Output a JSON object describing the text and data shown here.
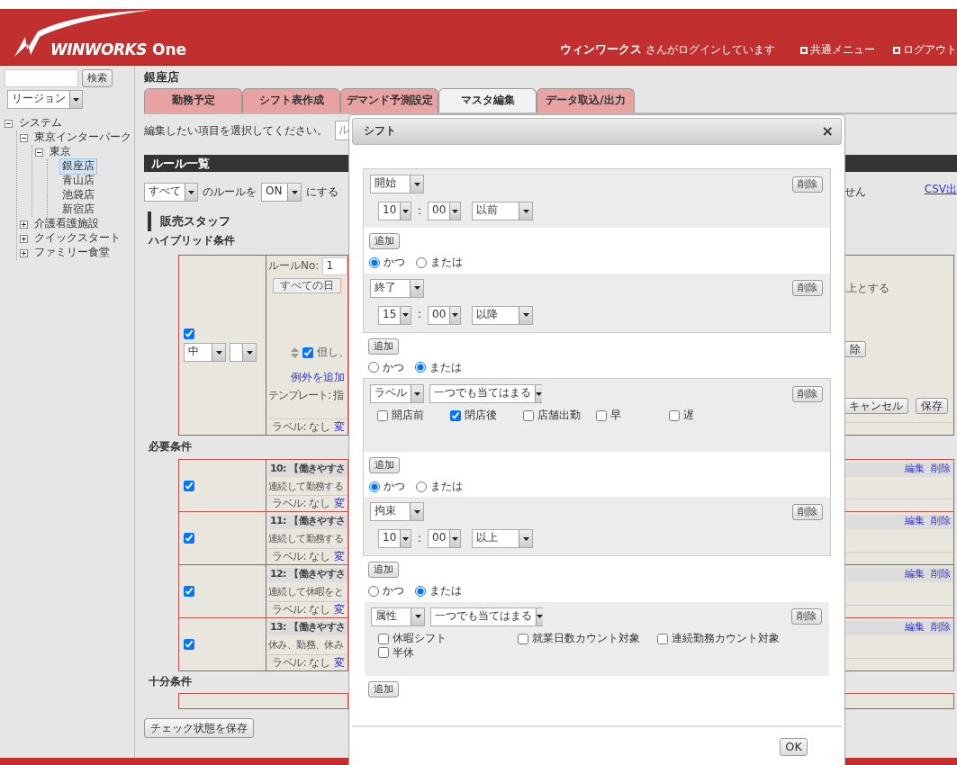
{
  "header": {
    "logo": {
      "word": "WINWORKS",
      "suffix": "One"
    },
    "user": {
      "name": "ウィンワークス",
      "suffix": "さんがログインしています"
    },
    "links": [
      "共通メニュー",
      "ログアウト"
    ]
  },
  "sidebar": {
    "search_button": "検索",
    "region_select": "リージョン",
    "tree": [
      {
        "label": "システム",
        "expanded": true,
        "selected": false,
        "children": [
          {
            "label": "東京インターパーク",
            "expanded": true,
            "selected": false,
            "children": [
              {
                "label": "東京",
                "expanded": true,
                "selected": false,
                "children": [
                  {
                    "label": "銀座店",
                    "selected": true
                  },
                  {
                    "label": "青山店",
                    "selected": false
                  },
                  {
                    "label": "池袋店",
                    "selected": false
                  },
                  {
                    "label": "新宿店",
                    "selected": false
                  }
                ]
              }
            ]
          },
          {
            "label": "介護看護施設",
            "expanded": false,
            "selected": false
          },
          {
            "label": "クイックスタート",
            "expanded": false,
            "selected": false
          },
          {
            "label": "ファミリー食堂",
            "expanded": false,
            "selected": false
          }
        ]
      }
    ]
  },
  "store_title": "銀座店",
  "tabs": [
    {
      "label": "勤務予定",
      "selected": false
    },
    {
      "label": "シフト表作成",
      "selected": false
    },
    {
      "label": "デマンド予測設定",
      "selected": false
    },
    {
      "label": "マスタ編集",
      "selected": true
    },
    {
      "label": "データ取込/出力",
      "selected": false
    }
  ],
  "main": {
    "instruction": "編集したい項目を選択してください。",
    "item_select": "ル",
    "section_title": "ルール一覧",
    "bulk": {
      "scope": "すべて",
      "text1": "のルールを",
      "state": "ON",
      "text2": "にする"
    },
    "notice": "せん",
    "csv_link": "CSV出",
    "group_title": "販売スタッフ",
    "hybrid": {
      "title": "ハイブリッド条件",
      "enabled": true,
      "priority": "中",
      "rule_no_label": "ルールNo:",
      "rule_no": "1",
      "day_button": "すべての日",
      "exception_checked": true,
      "exception_text": "但し、",
      "add_exception": "例外を追加",
      "template": "テンプレート: 指",
      "label_text": "ラベル: なし",
      "change_link": "変",
      "right_text": "上とする",
      "delete_button": "除",
      "cancel_button": "キャンセル",
      "save_button": "保存"
    },
    "required": {
      "title": "必要条件",
      "rules": [
        {
          "checked": true,
          "title": "10: 【働きやすさ",
          "summary": "連続して勤務する",
          "label_text": "ラベル: なし",
          "change_link": "変",
          "edit_link": "編集",
          "delete_link": "削除"
        },
        {
          "checked": true,
          "title": "11: 【働きやすさ",
          "summary": "連続して勤務する",
          "label_text": "ラベル: なし",
          "change_link": "変",
          "edit_link": "編集",
          "delete_link": "削除"
        },
        {
          "checked": true,
          "title": "12: 【働きやすさ",
          "summary": "連続して休暇をと",
          "label_text": "ラベル: なし",
          "change_link": "変",
          "edit_link": "編集",
          "delete_link": "削除"
        },
        {
          "checked": true,
          "title": "13: 【働きやすさ",
          "summary": "休み、勤務、休み",
          "label_text": "ラベル: なし",
          "change_link": "変",
          "edit_link": "編集",
          "delete_link": "削除"
        }
      ]
    },
    "sufficient": {
      "title": "十分条件"
    },
    "save_button": "チェック状態を保存"
  },
  "modal": {
    "title": "シフト",
    "close": "×",
    "ok_button": "OK",
    "blocks": [
      {
        "kind": "group",
        "items": [
          {
            "kind": "time",
            "field": "開始",
            "delete": "削除",
            "hour": "10",
            "separator": ":",
            "minute": "00",
            "compare": "以前"
          },
          {
            "kind": "join",
            "add": "追加",
            "options": [
              {
                "label": "かつ",
                "selected": true
              },
              {
                "label": "または",
                "selected": false
              }
            ]
          },
          {
            "kind": "time",
            "field": "終了",
            "delete": "削除",
            "hour": "15",
            "separator": ":",
            "minute": "00",
            "compare": "以降"
          }
        ]
      },
      {
        "kind": "join",
        "add": "追加",
        "options": [
          {
            "label": "かつ",
            "selected": false
          },
          {
            "label": "または",
            "selected": true
          }
        ]
      },
      {
        "kind": "group",
        "items": [
          {
            "kind": "label",
            "field": "ラベル",
            "match": "一つでも当てはまる",
            "delete": "削除",
            "options": [
              {
                "label": "開店前",
                "checked": false
              },
              {
                "label": "閉店後",
                "checked": true
              },
              {
                "label": "店舗出勤",
                "checked": false
              },
              {
                "label": "早",
                "checked": false
              },
              {
                "label": "遅",
                "checked": false
              }
            ]
          },
          {
            "kind": "join",
            "add": "追加",
            "options": [
              {
                "label": "かつ",
                "selected": true
              },
              {
                "label": "または",
                "selected": false
              }
            ]
          },
          {
            "kind": "time",
            "field": "拘束",
            "delete": "削除",
            "hour": "10",
            "separator": ":",
            "minute": "00",
            "compare": "以上"
          }
        ]
      },
      {
        "kind": "join",
        "add": "追加",
        "options": [
          {
            "label": "かつ",
            "selected": false
          },
          {
            "label": "または",
            "selected": true
          }
        ]
      },
      {
        "kind": "plain",
        "items": [
          {
            "kind": "attribute",
            "field": "属性",
            "match": "一つでも当てはまる",
            "delete": "削除",
            "options": [
              {
                "label": "休暇シフト",
                "checked": false
              },
              {
                "label": "就業日数カウント対象",
                "checked": false
              },
              {
                "label": "連続勤務カウント対象",
                "checked": false
              },
              {
                "label": "半休",
                "checked": false
              }
            ]
          }
        ]
      },
      {
        "kind": "add",
        "add": "追加"
      }
    ]
  }
}
